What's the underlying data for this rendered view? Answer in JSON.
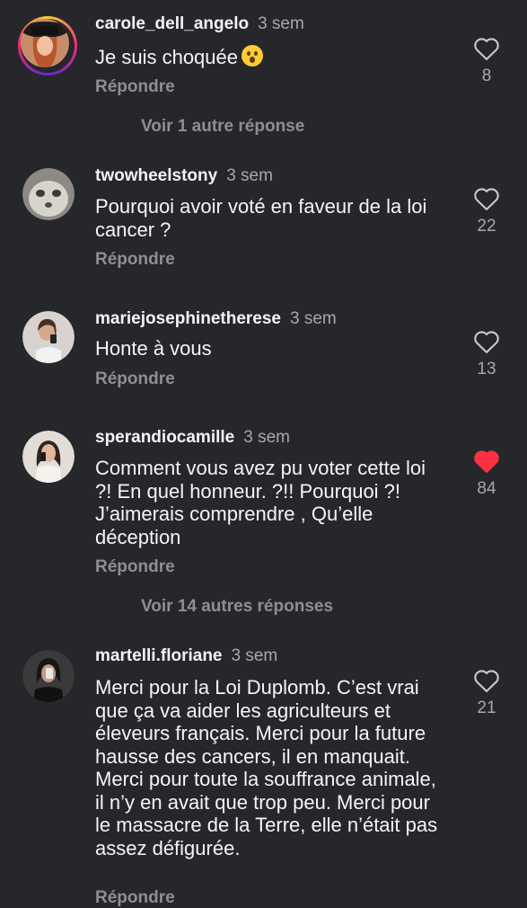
{
  "comments": [
    {
      "username": "carole_dell_angelo",
      "time": "3 sem",
      "text": "Je suis choquée",
      "emoji": "astonished-face-emoji",
      "reply": "Répondre",
      "likes": "8",
      "liked": false,
      "more_replies": "Voir 1 autre réponse"
    },
    {
      "username": "twowheelstony",
      "time": "3 sem",
      "text": "Pourquoi avoir voté en faveur de la loi cancer ?",
      "reply": "Répondre",
      "likes": "22",
      "liked": false
    },
    {
      "username": "mariejosephinetherese",
      "time": "3 sem",
      "text": "Honte à vous",
      "reply": "Répondre",
      "likes": "13",
      "liked": false
    },
    {
      "username": "sperandiocamille",
      "time": "3 sem",
      "text": "Comment vous avez pu voter cette loi ?! En quel honneur. ?!! Pourquoi ?! J’aimerais comprendre , Qu’elle déception",
      "reply": "Répondre",
      "likes": "84",
      "liked": true,
      "more_replies": "Voir 14 autres réponses"
    },
    {
      "username": "martelli.floriane",
      "time": "3 sem",
      "text": "Merci pour la Loi Duplomb. C’est vrai que ça va aider les agriculteurs et éleveurs français. Merci pour la future hausse des cancers, il en manquait. Merci pour toute la souffrance animale, il n’y en avait que trop peu. Merci pour le massacre de la Terre, elle n’était pas assez défigurée.",
      "reply": "Répondre",
      "likes": "21",
      "liked": false
    }
  ],
  "colors": {
    "background": "#26272b",
    "liked_heart": "#ff3040",
    "secondary_text": "#a7a8ac"
  }
}
